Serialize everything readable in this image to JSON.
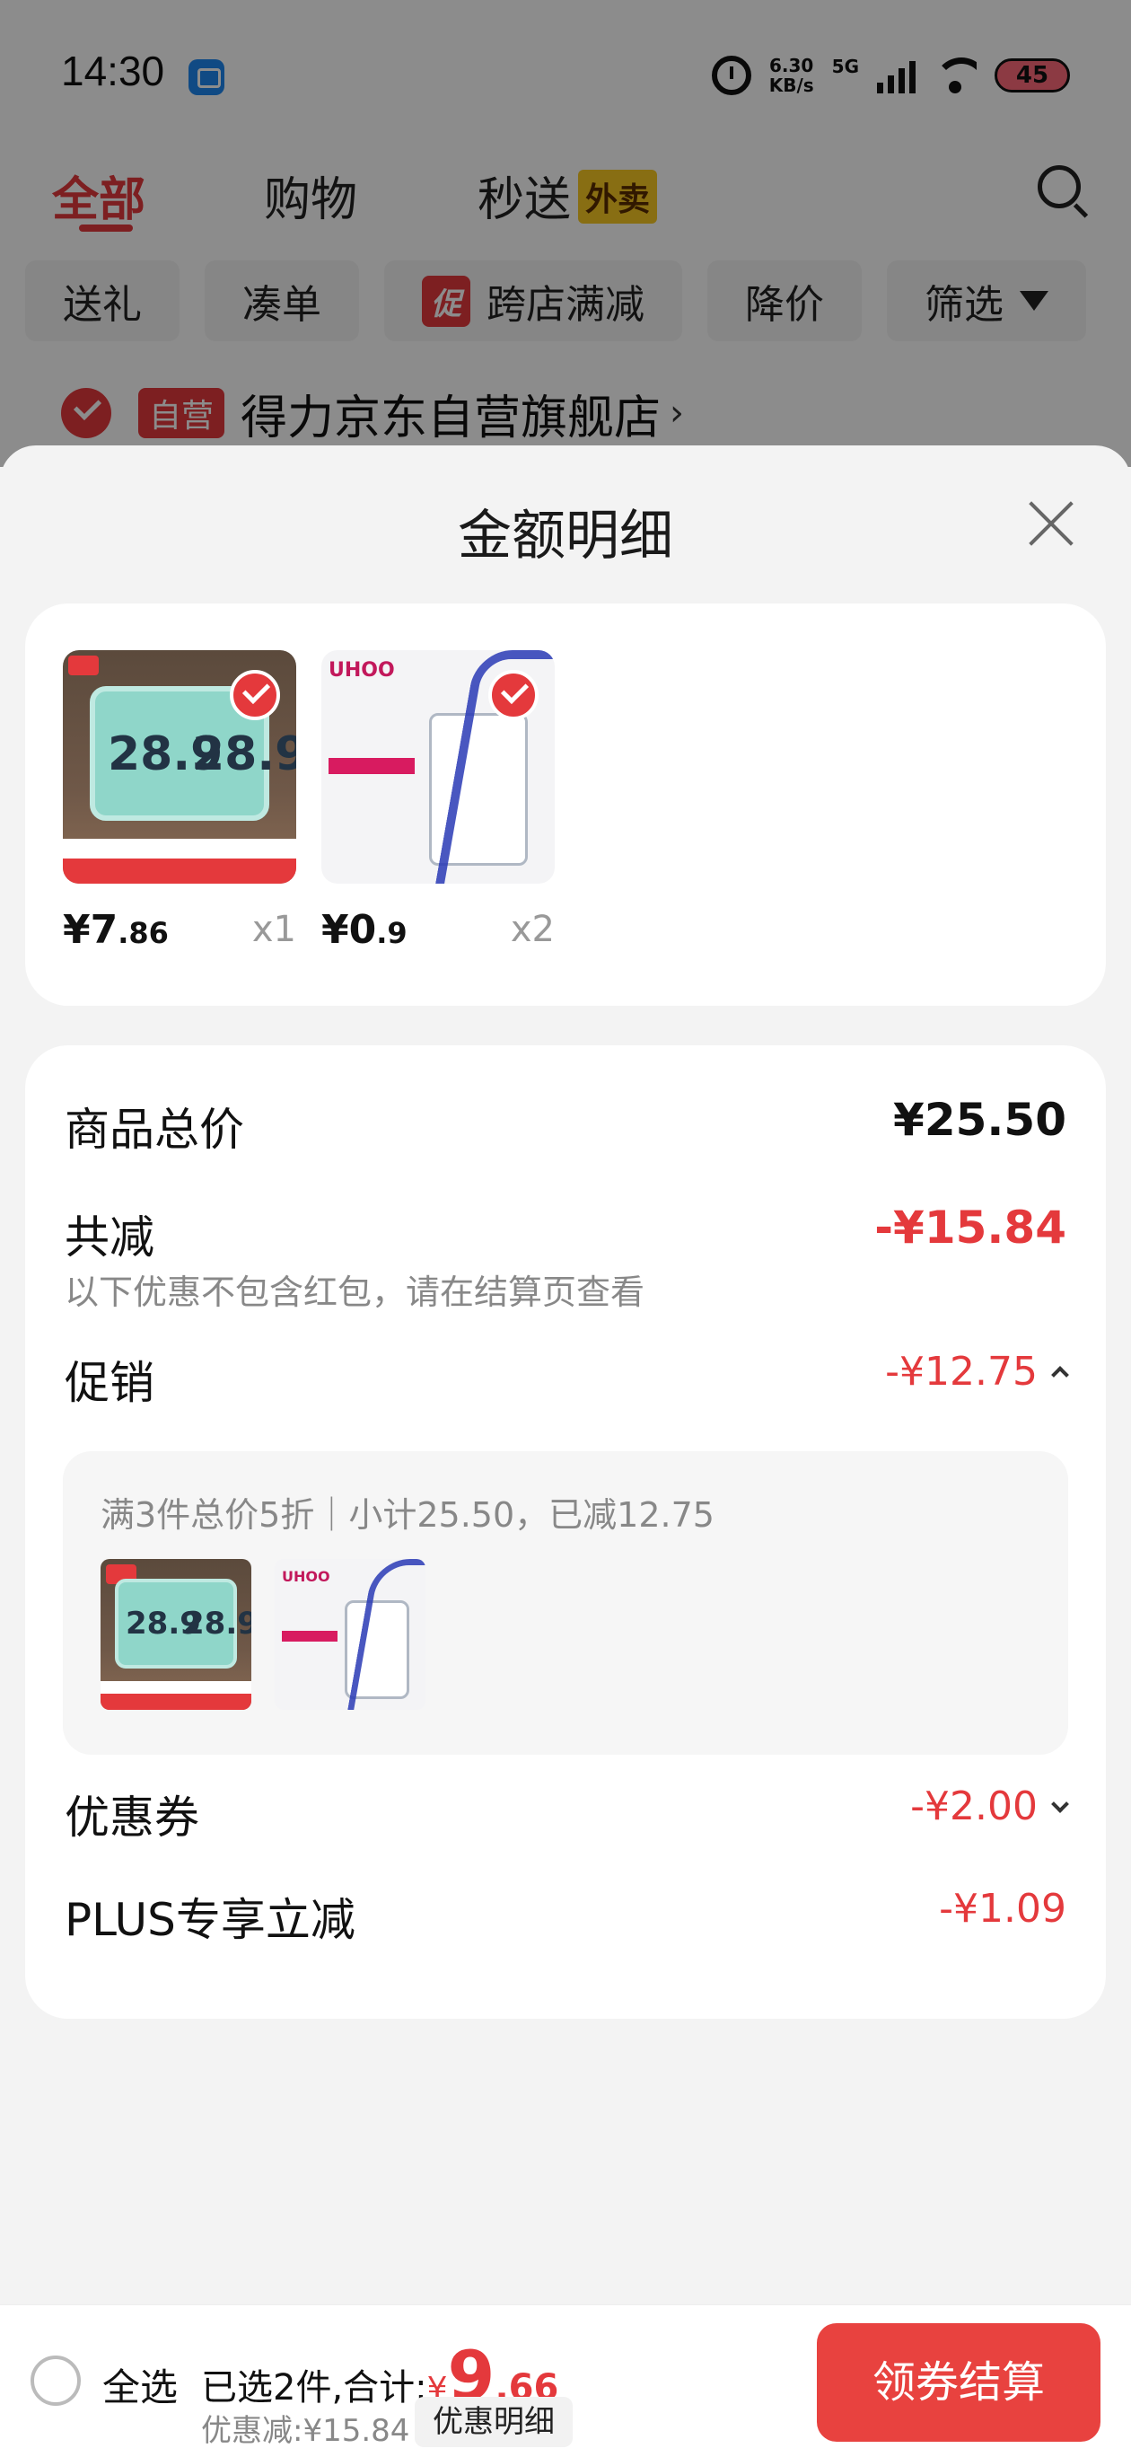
{
  "status_bar": {
    "time": "14:30",
    "net_speed_value": "6.30",
    "net_speed_unit": "KB/s",
    "network": "5G",
    "battery": "45"
  },
  "header": {
    "tabs": [
      {
        "label": "全部",
        "active": true
      },
      {
        "label": "购物",
        "active": false
      },
      {
        "label": "秒送",
        "badge": "外卖",
        "active": false
      }
    ],
    "filters": [
      "送礼",
      "凑单",
      "跨店满减",
      "降价",
      "筛选"
    ],
    "promo_tag": "促"
  },
  "store": {
    "tag": "自营",
    "name": "得力京东自营旗舰店"
  },
  "sheet": {
    "title": "金额明细",
    "products": [
      {
        "price_int": "¥7",
        "price_dec": ".86",
        "qty": "x1",
        "icon": "thermometer-image"
      },
      {
        "price_int": "¥0",
        "price_dec": ".9",
        "qty": "x2",
        "icon": "card-holder-image"
      }
    ],
    "summary": {
      "total_label": "商品总价",
      "total_value": "¥25.50",
      "discount_label": "共减",
      "discount_value": "-¥15.84",
      "discount_note": "以下优惠不包含红包，请在结算页查看",
      "promo_label": "促销",
      "promo_value": "-¥12.75",
      "promo_detail": "满3件总价5折｜小计25.50，已减12.75",
      "coupon_label": "优惠券",
      "coupon_value": "-¥2.00",
      "plus_label": "PLUS专享立减",
      "plus_value": "-¥1.09"
    }
  },
  "bottom_bar": {
    "select_all": "全选",
    "selected_text": "已选2件,合计:",
    "total_yen": "¥",
    "total_int": "9",
    "total_dec": ".66",
    "discount_text": "优惠减:¥15.84",
    "detail_button": "优惠明细",
    "checkout_button": "领券结算"
  },
  "colors": {
    "accent": "#e4393c",
    "checkout": "#e8423f"
  }
}
